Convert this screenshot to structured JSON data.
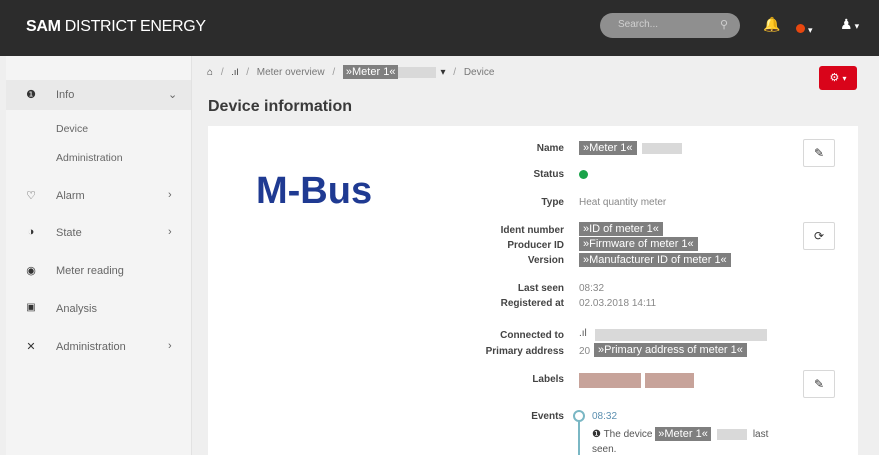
{
  "topbar": {
    "brand_bold": "SAM",
    "brand_rest": " DISTRICT ENERGY",
    "search_placeholder": "Search...",
    "search_icon": "search-icon",
    "bell_icon": "bell-icon",
    "status_icon": "status-dot-icon",
    "user_icon": "user-icon",
    "caret": "▾"
  },
  "sidebar": {
    "items": [
      {
        "label": "Info",
        "icon": "info-icon",
        "chevron": "⌄"
      },
      {
        "label": "Alarm",
        "icon": "bell-outline-icon",
        "chevron": "›"
      },
      {
        "label": "State",
        "icon": "half-circle-icon",
        "chevron": "›"
      },
      {
        "label": "Meter reading",
        "icon": "binoculars-icon",
        "chevron": ""
      },
      {
        "label": "Analysis",
        "icon": "bar-chart-icon",
        "chevron": ""
      },
      {
        "label": "Administration",
        "icon": "wrench-icon",
        "chevron": "›"
      }
    ],
    "sub_items": [
      "Device",
      "Administration"
    ]
  },
  "breadcrumb": {
    "home_icon": "home-icon",
    "signal_icon": "signal-icon",
    "meter_overview": "Meter overview",
    "meter": "»Meter 1«",
    "device": "Device"
  },
  "action_button": {
    "icon": "gear-icon",
    "caret": "▾"
  },
  "page_title": "Device information",
  "logo_text": "M-Bus",
  "fields": {
    "name": {
      "label": "Name",
      "value": "»Meter 1«"
    },
    "status": {
      "label": "Status",
      "color": "#1aa34a"
    },
    "type": {
      "label": "Type",
      "value": "Heat quantity meter"
    },
    "ident_number": {
      "label": "Ident number",
      "value": "»ID of meter 1«"
    },
    "producer_id": {
      "label": "Producer ID",
      "value": "»Firmware of meter 1«"
    },
    "version": {
      "label": "Version",
      "value": "»Manufacturer ID of meter 1«"
    },
    "last_seen": {
      "label": "Last seen",
      "value": "08:32"
    },
    "registered_at": {
      "label": "Registered at",
      "value": "02.03.2018 14:11"
    },
    "connected_to": {
      "label": "Connected to"
    },
    "primary_address": {
      "label": "Primary address",
      "prefix": "20",
      "value": "»Primary address of meter 1«"
    },
    "labels": {
      "label": "Labels"
    },
    "events": {
      "label": "Events",
      "time": "08:32",
      "text_before": "The device ",
      "meter": "»Meter 1«",
      "text_after": "last",
      "text_end": "seen."
    }
  },
  "colors": {
    "accent_red": "#d9041a",
    "brand_blue": "#1f3a92",
    "topbar": "#2c2c2c"
  }
}
